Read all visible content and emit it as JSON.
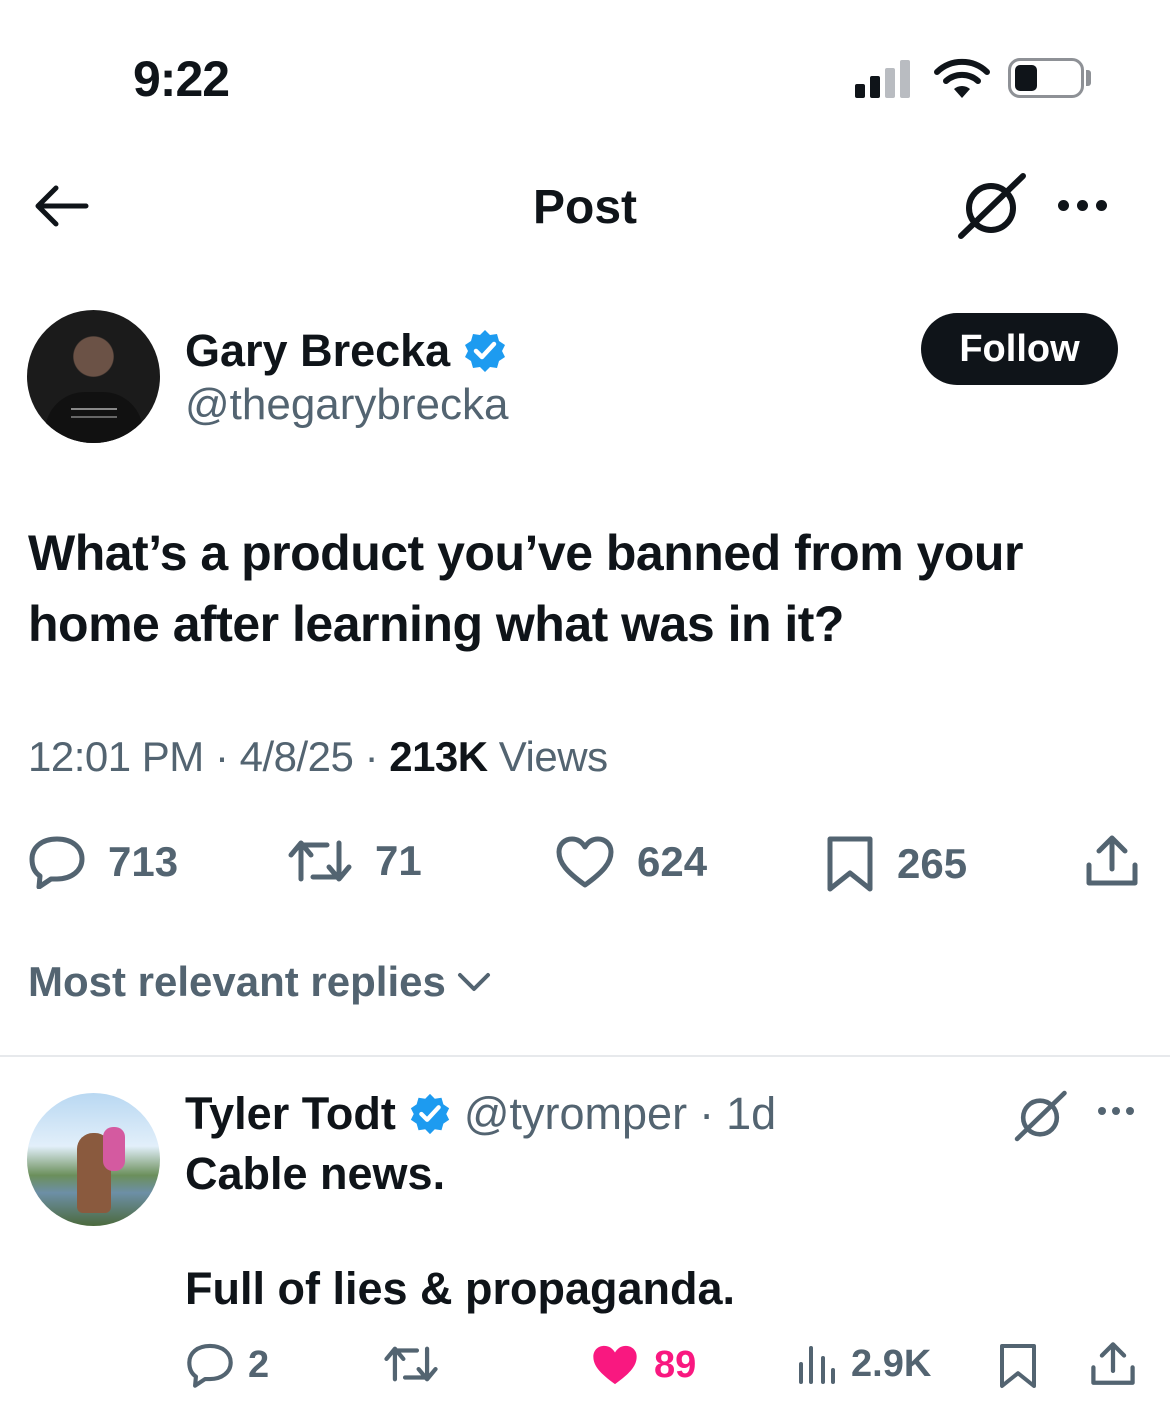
{
  "status_bar": {
    "time": "9:22"
  },
  "nav": {
    "title": "Post"
  },
  "author": {
    "name": "Gary Brecka",
    "handle": "@thegarybrecka",
    "verified": true,
    "follow_label": "Follow"
  },
  "tweet": {
    "text": "What’s a product you’ve banned from your home after learning what was in it?",
    "time": "12:01 PM",
    "date": "4/8/25",
    "views_count": "213K",
    "views_label": "Views",
    "replies": "713",
    "reposts": "71",
    "likes": "624",
    "bookmarks": "265"
  },
  "replies_sort": {
    "label": "Most relevant replies"
  },
  "reply": {
    "name": "Tyler Todt",
    "handle": "@tyromper",
    "age": "1d",
    "verified": true,
    "line1": "Cable news.",
    "line2": "Full of lies & propaganda.",
    "replies": "2",
    "likes": "89",
    "views": "2.9K",
    "liked": true
  },
  "colors": {
    "text": "#0f1419",
    "muted": "#536471",
    "verified_blue": "#1d9bf0",
    "like_pink": "#f91880"
  }
}
